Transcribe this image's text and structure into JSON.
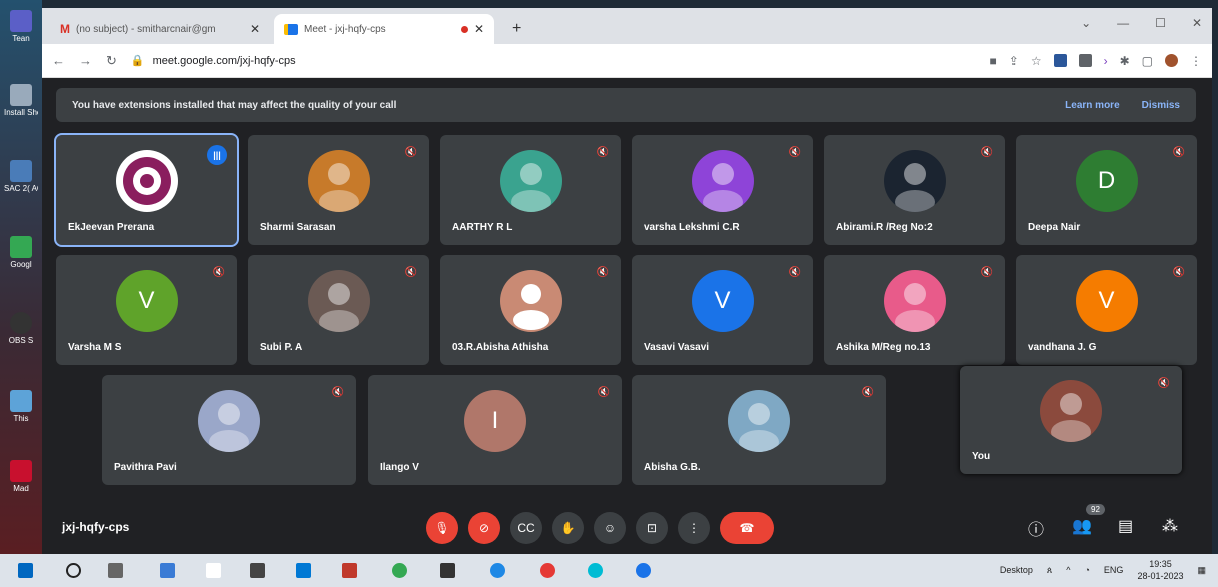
{
  "desktop_icons": [
    "Tean",
    "Install She",
    "SAC 2( ACTIV",
    "Googl",
    "OBS S",
    "This",
    "Mad"
  ],
  "tabs": [
    {
      "label": "(no subject) - smitharcnair@gm",
      "icon": "gmail-icon"
    },
    {
      "label": "Meet - jxj-hqfy-cps",
      "icon": "meet-icon"
    }
  ],
  "window_controls": [
    "⌄",
    "—",
    "☐",
    "✕"
  ],
  "address": {
    "url": "meet.google.com/jxj-hqfy-cps"
  },
  "banner": {
    "message": "You have extensions installed that may affect the quality of your call",
    "learn_more": "Learn more",
    "dismiss": "Dismiss"
  },
  "participants": [
    {
      "name": "EkJeevan Prerana",
      "avatar": "logo",
      "color": "#ffffff",
      "speaking": true
    },
    {
      "name": "Sharmi Sarasan",
      "avatar": "photo",
      "color": "#c77a2a"
    },
    {
      "name": "AARTHY R L",
      "avatar": "photo",
      "color": "#3aa38f"
    },
    {
      "name": "varsha Lekshmi C.R",
      "avatar": "photo",
      "color": "#8e44d8"
    },
    {
      "name": "Abirami.R /Reg No:2",
      "avatar": "photo",
      "color": "#1b2430"
    },
    {
      "name": "Deepa Nair",
      "avatar": "D",
      "color": "#2e7d32"
    },
    {
      "name": "Varsha M S",
      "avatar": "V",
      "color": "#5fa32a"
    },
    {
      "name": "Subi P. A",
      "avatar": "photo",
      "color": "#6b5a54"
    },
    {
      "name": "03.R.Abisha Athisha",
      "avatar": "person",
      "color": "#c98a74"
    },
    {
      "name": "Vasavi Vasavi",
      "avatar": "V",
      "color": "#1a73e8"
    },
    {
      "name": "Ashika M/Reg no.13",
      "avatar": "photo",
      "color": "#e85b8a"
    },
    {
      "name": "vandhana J. G",
      "avatar": "V",
      "color": "#f57c00"
    },
    {
      "name": "Pavithra Pavi",
      "avatar": "photo",
      "color": "#9aa7c9"
    },
    {
      "name": "Ilango V",
      "avatar": "I",
      "color": "#b0776a"
    },
    {
      "name": "Abisha G.B.",
      "avatar": "photo",
      "color": "#7fa8c4"
    },
    {
      "name": "You",
      "avatar": "photo",
      "color": "#8b4a3d"
    }
  ],
  "meeting_code": "jxj-hqfy-cps",
  "people_count": "92",
  "taskbar": {
    "desktop_label": "Desktop",
    "lang": "ENG",
    "time": "19:35",
    "date": "28-01-2023"
  }
}
